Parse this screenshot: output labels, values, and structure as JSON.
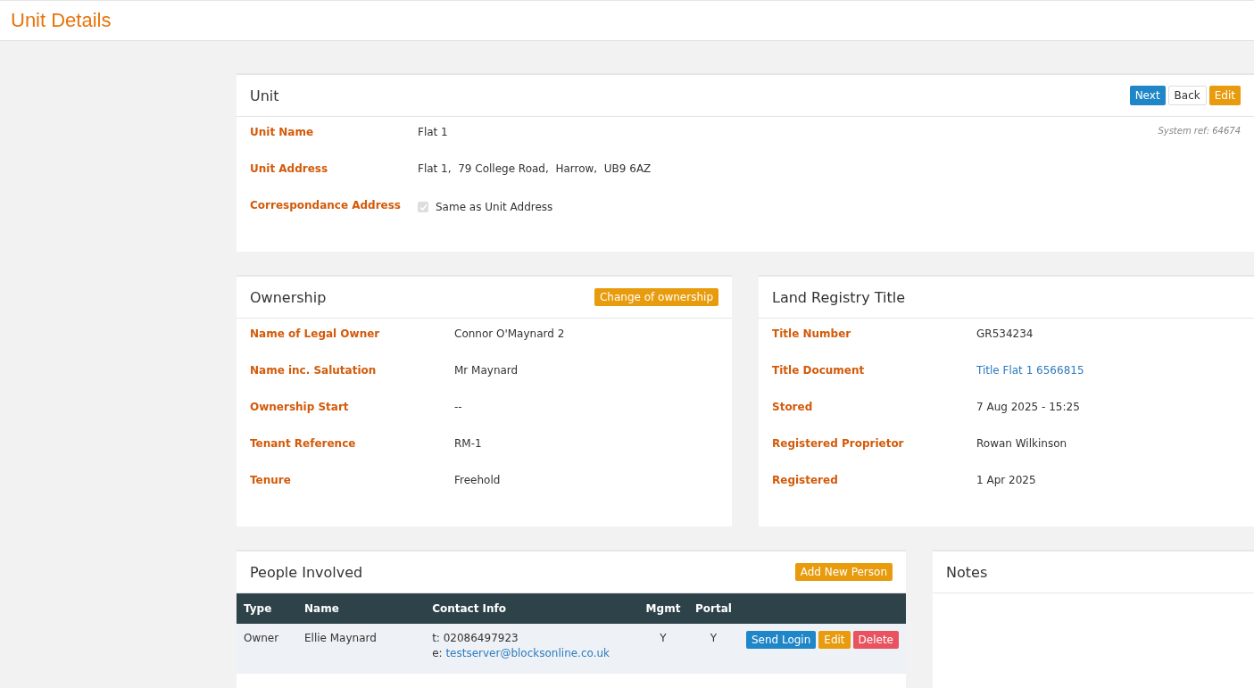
{
  "page_title": "Unit Details",
  "unit": {
    "title": "Unit",
    "buttons": [
      {
        "label": "Next",
        "kind": "primary"
      },
      {
        "label": "Back",
        "kind": "default"
      },
      {
        "label": "Edit",
        "kind": "warning"
      }
    ],
    "system_ref": "System ref: 64674",
    "fields": [
      {
        "label": "Unit Name",
        "value": "Flat 1"
      },
      {
        "label": "Unit Address",
        "value": "Flat 1,  79 College Road,  Harrow,  UB9 6AZ"
      }
    ],
    "correspondence": {
      "label": "Correspondance Address",
      "checkbox_label": "Same as Unit Address",
      "checked": true
    }
  },
  "ownership": {
    "title": "Ownership",
    "button": "Change of ownership",
    "fields": [
      {
        "label": "Name of Legal Owner",
        "value": "Connor O'Maynard 2",
        "kind": "text"
      },
      {
        "label": "Name inc. Salutation",
        "value": "Mr Maynard",
        "kind": "text"
      },
      {
        "label": "Ownership Start",
        "value": "--",
        "kind": "text"
      },
      {
        "label": "Tenant Reference",
        "value": "RM-1",
        "kind": "text"
      },
      {
        "label": "Tenure",
        "value": "Freehold",
        "kind": "text"
      }
    ]
  },
  "land_registry": {
    "title": "Land Registry Title",
    "fields": [
      {
        "label": "Title Number",
        "value": "GR534234",
        "kind": "text"
      },
      {
        "label": "Title Document",
        "value": "Title Flat 1 6566815",
        "kind": "link"
      },
      {
        "label": "Stored",
        "value": "7 Aug 2025 - 15:25",
        "kind": "text"
      },
      {
        "label": "Registered Proprietor",
        "value": "Rowan Wilkinson",
        "kind": "text"
      },
      {
        "label": "Registered",
        "value": "1 Apr 2025",
        "kind": "text"
      }
    ]
  },
  "people": {
    "title": "People Involved",
    "button": "Add New Person",
    "columns": [
      "Type",
      "Name",
      "Contact Info",
      "Mgmt",
      "Portal"
    ],
    "rows": [
      {
        "type": "Owner",
        "name": "Ellie Maynard",
        "phone": "t: 02086497923",
        "email_prefix": "e:",
        "email": "testserver@blocksonline.co.uk",
        "mgmt": "Y",
        "portal": "Y",
        "actions": [
          {
            "label": "Send Login",
            "kind": "primary"
          },
          {
            "label": "Edit",
            "kind": "warning"
          },
          {
            "label": "Delete",
            "kind": "danger"
          }
        ]
      }
    ]
  },
  "notes": {
    "title": "Notes"
  }
}
